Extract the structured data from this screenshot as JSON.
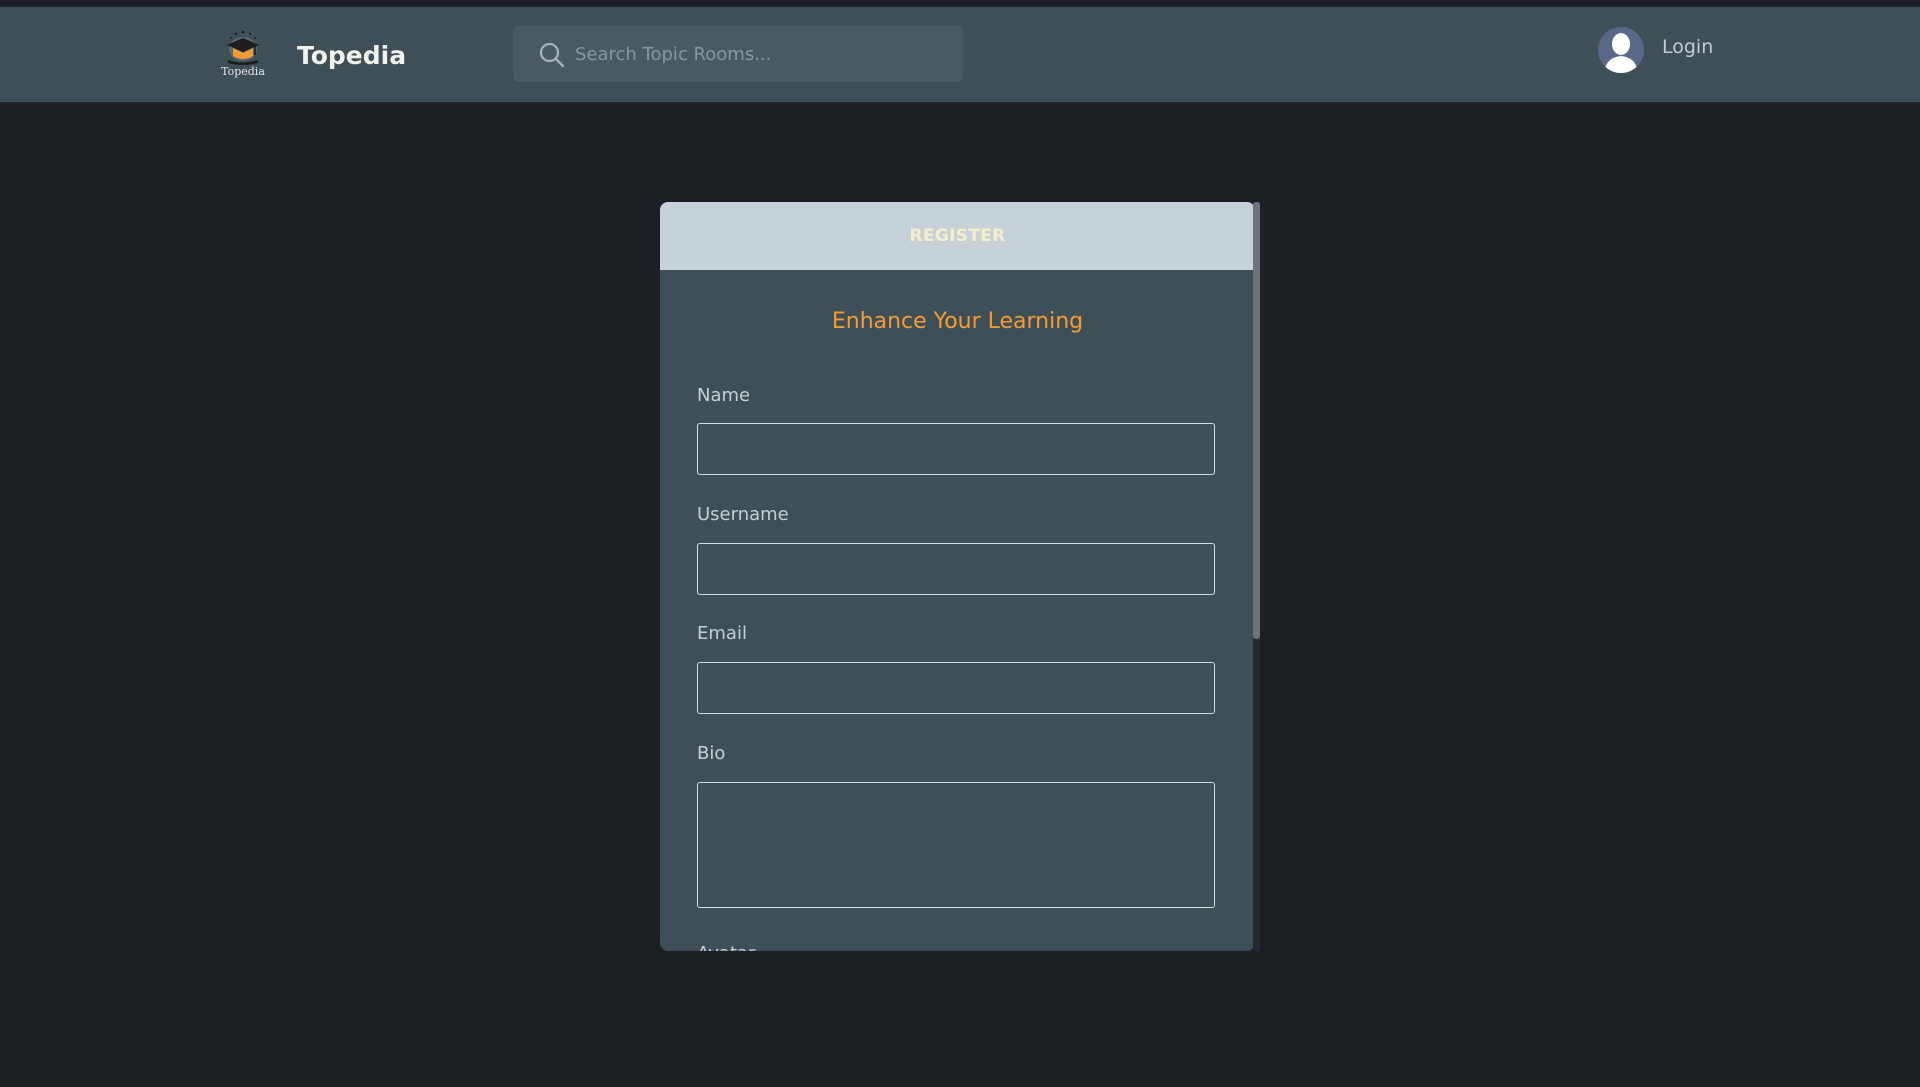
{
  "header": {
    "logo_caption": "Topedia",
    "brand": "Topedia",
    "search_placeholder": "Search Topic Rooms...",
    "login_label": "Login"
  },
  "register": {
    "header_label": "REGISTER",
    "subtitle": "Enhance Your Learning",
    "fields": [
      {
        "label": "Name",
        "value": ""
      },
      {
        "label": "Username",
        "value": ""
      },
      {
        "label": "Email",
        "value": ""
      },
      {
        "label": "Bio",
        "value": ""
      }
    ],
    "next_label_partial": "Avatar"
  },
  "colors": {
    "background": "#1c2024",
    "header_bg": "#3f4f57",
    "card_bg": "#3f4f57",
    "card_header_bg": "#c7d2d6",
    "accent": "#f39c33"
  },
  "icons": {
    "logo": "graduation-cap-logo",
    "search": "search-icon",
    "avatar": "user-avatar-icon"
  }
}
